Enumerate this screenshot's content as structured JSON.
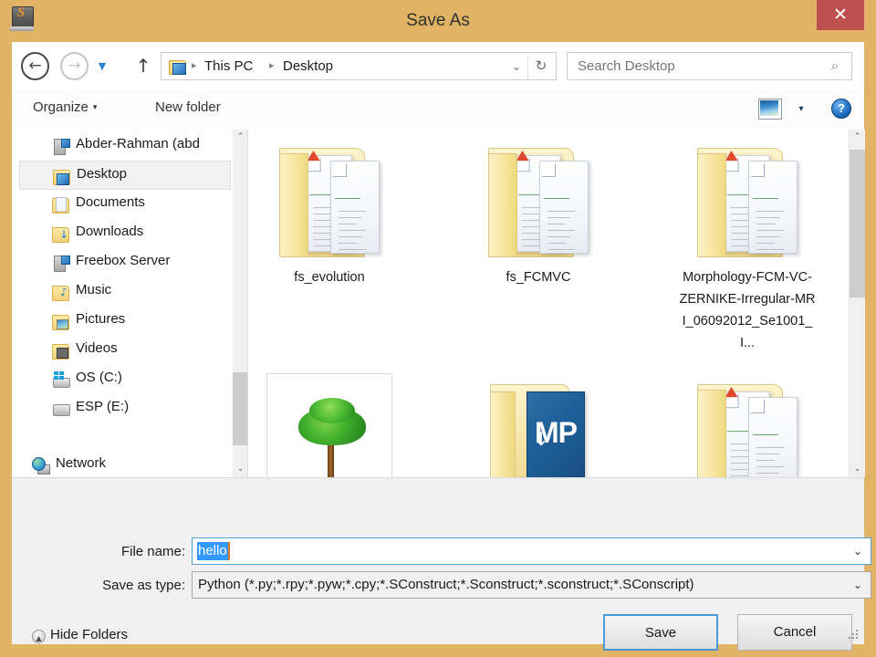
{
  "window": {
    "title": "Save As",
    "app_icon": "sublime-text-icon",
    "close_label": "✕",
    "border_color": "#e0b464",
    "close_button_color": "#c0504f"
  },
  "nav": {
    "back_icon": "arrow-left-icon",
    "back_glyph": "←",
    "forward_icon": "arrow-right-icon",
    "forward_glyph": "→",
    "recent_glyph": "▼",
    "up_glyph": "↑",
    "breadcrumb": {
      "folder_icon": "folder-icon",
      "separator": "▸",
      "crumbs": [
        "This PC",
        "Desktop"
      ],
      "dropdown_glyph": "⌄",
      "refresh_glyph": "↻"
    },
    "search": {
      "placeholder": "Search Desktop",
      "value": "",
      "icon": "search-icon",
      "icon_glyph": "⌕"
    }
  },
  "commandbar": {
    "organize_label": "Organize",
    "organize_caret": "▾",
    "newfolder_label": "New folder",
    "viewmode_icon": "view-options-icon",
    "viewmode_caret": "▾",
    "help_icon": "help-icon",
    "help_glyph": "?"
  },
  "sidebar": {
    "items": [
      {
        "label": "Abder-Rahman (abd",
        "icon": "media-server-icon",
        "selected": false,
        "root": false
      },
      {
        "label": "Desktop",
        "icon": "desktop-folder-icon",
        "selected": true,
        "root": false
      },
      {
        "label": "Documents",
        "icon": "documents-folder-icon",
        "selected": false,
        "root": false
      },
      {
        "label": "Downloads",
        "icon": "downloads-folder-icon",
        "selected": false,
        "root": false
      },
      {
        "label": "Freebox Server",
        "icon": "media-server-icon",
        "selected": false,
        "root": false
      },
      {
        "label": "Music",
        "icon": "music-folder-icon",
        "selected": false,
        "root": false
      },
      {
        "label": "Pictures",
        "icon": "pictures-folder-icon",
        "selected": false,
        "root": false
      },
      {
        "label": "Videos",
        "icon": "videos-folder-icon",
        "selected": false,
        "root": false
      },
      {
        "label": "OS (C:)",
        "icon": "hard-drive-windows-icon",
        "selected": false,
        "root": false
      },
      {
        "label": "ESP (E:)",
        "icon": "hard-drive-icon",
        "selected": false,
        "root": false
      },
      {
        "label": "Network",
        "icon": "network-icon",
        "selected": false,
        "root": true
      }
    ],
    "scrollbar": {
      "up_glyph": "⌃",
      "down_glyph": "⌄"
    }
  },
  "filelist": {
    "items": [
      {
        "label": "fs_evolution",
        "icon": "document-folder-icon"
      },
      {
        "label": "fs_FCMVC",
        "icon": "document-folder-icon"
      },
      {
        "label": "Morphology-FCM-VC-ZERNIKE-Irregular-MRI_06092012_Se1001_I...",
        "icon": "document-folder-icon"
      },
      {
        "label": "",
        "icon": "image-thumbnail-tree-icon"
      },
      {
        "label": "",
        "icon": "xampp-folder-icon",
        "badge_text": "MP"
      },
      {
        "label": "",
        "icon": "document-folder-icon"
      }
    ],
    "scrollbar": {
      "up_glyph": "⌃",
      "down_glyph": "⌄"
    }
  },
  "form": {
    "filename_label": "File name:",
    "filename_value": "hello",
    "filename_selected": true,
    "filetype_label": "Save as type:",
    "filetype_value": "Python (*.py;*.rpy;*.pyw;*.cpy;*.SConstruct;*.Sconstruct;*.sconstruct;*.SConscript)",
    "combo_arrow": "⌄",
    "selection_color": "#3399ff"
  },
  "footer": {
    "hide_folders_label": "Hide Folders",
    "hide_folders_caret": "▲",
    "save_label": "Save",
    "cancel_label": "Cancel"
  }
}
